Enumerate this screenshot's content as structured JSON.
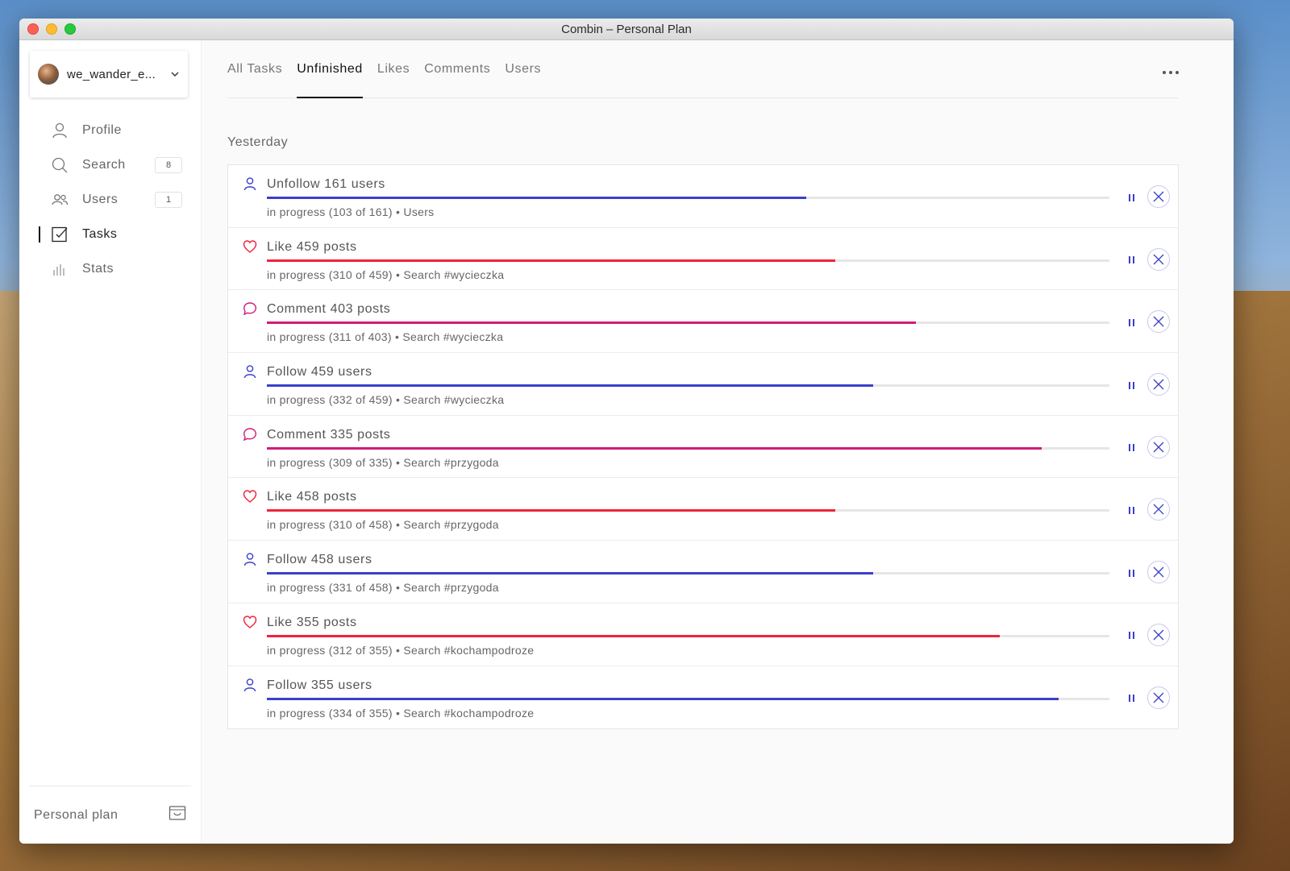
{
  "window": {
    "title": "Combin – Personal Plan"
  },
  "account": {
    "username": "we_wander_e..."
  },
  "sidebar": {
    "items": [
      {
        "label": "Profile",
        "icon": "person-icon",
        "badge": ""
      },
      {
        "label": "Search",
        "icon": "search-icon",
        "badge": "8"
      },
      {
        "label": "Users",
        "icon": "users-icon",
        "badge": "1"
      },
      {
        "label": "Tasks",
        "icon": "tasks-icon",
        "badge": "",
        "active": true
      },
      {
        "label": "Stats",
        "icon": "stats-icon",
        "badge": ""
      }
    ],
    "footer": {
      "plan_label": "Personal plan",
      "icon": "plan-icon"
    }
  },
  "tabs": [
    {
      "label": "All Tasks"
    },
    {
      "label": "Unfinished",
      "active": true
    },
    {
      "label": "Likes"
    },
    {
      "label": "Comments"
    },
    {
      "label": "Users"
    }
  ],
  "section": {
    "title": "Yesterday"
  },
  "colors": {
    "follow": "#3b3fc9",
    "like": "#f0243c",
    "comment": "#d11b7a",
    "track": "#e6e6e6"
  },
  "tasks": [
    {
      "type": "follow",
      "title": "Unfollow 161 users",
      "progress": 0.64,
      "subtitle": "in progress (103 of 161) • Users"
    },
    {
      "type": "like",
      "title": "Like 459 posts",
      "progress": 0.675,
      "subtitle": "in progress (310 of 459) • Search #wycieczka"
    },
    {
      "type": "comment",
      "title": "Comment 403 posts",
      "progress": 0.77,
      "subtitle": "in progress (311 of 403) • Search #wycieczka"
    },
    {
      "type": "follow",
      "title": "Follow 459 users",
      "progress": 0.72,
      "subtitle": "in progress (332 of 459) • Search #wycieczka"
    },
    {
      "type": "comment",
      "title": "Comment 335 posts",
      "progress": 0.92,
      "subtitle": "in progress (309 of 335) • Search #przygoda"
    },
    {
      "type": "like",
      "title": "Like 458 posts",
      "progress": 0.675,
      "subtitle": "in progress (310 of 458) • Search #przygoda"
    },
    {
      "type": "follow",
      "title": "Follow 458 users",
      "progress": 0.72,
      "subtitle": "in progress (331 of 458) • Search #przygoda"
    },
    {
      "type": "like",
      "title": "Like 355 posts",
      "progress": 0.87,
      "subtitle": "in progress (312 of 355) • Search #kochampodroze"
    },
    {
      "type": "follow",
      "title": "Follow 355 users",
      "progress": 0.94,
      "subtitle": "in progress (334 of 355) • Search #kochampodroze"
    }
  ]
}
